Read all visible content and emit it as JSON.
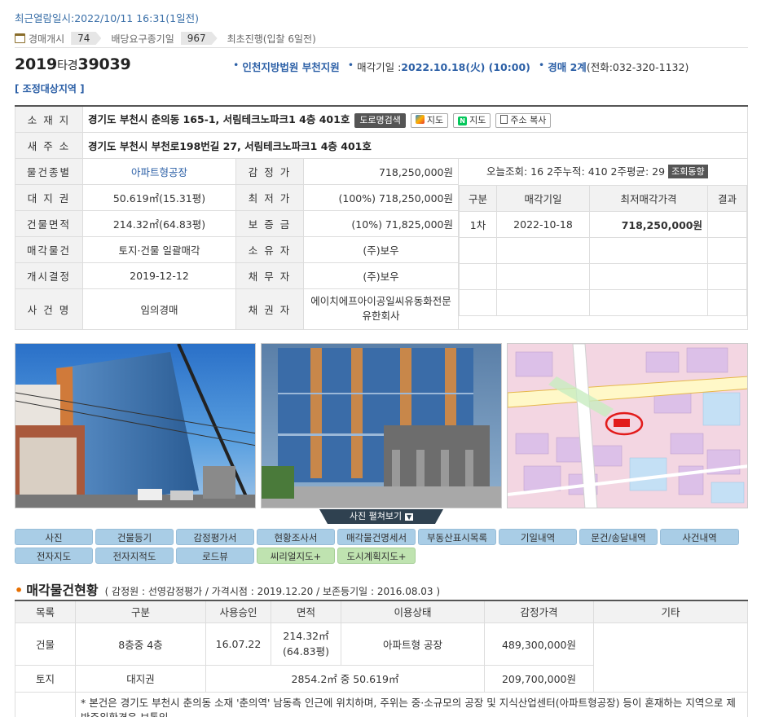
{
  "recent_view": "최근열람일시:2022/10/11 16:31(1일전)",
  "stats": {
    "auction_start_label": "경매개시",
    "auction_start_count": "74",
    "dividend_label": "배당요구종기일",
    "dividend_count": "967",
    "first_proceed": "최초진행(입찰 6일전)"
  },
  "case": {
    "year": "2019",
    "type": "타경",
    "number": "39039",
    "court": "인천지방법원 부천지원",
    "sale_date_label": "매각기일 : ",
    "sale_date": "2022.10.18(火) (10:00)",
    "dept": "경매 2계",
    "phone": "(전화:032-320-1132)",
    "adjust_area": "[ 조정대상지역 ]"
  },
  "buttons": {
    "road_search": "도로명검색",
    "daum_map": "지도",
    "naver_map": "지도",
    "copy_address": "주소 복사",
    "trend": "조회동향"
  },
  "info": {
    "location_label": "소 재 지",
    "location": "경기도 부천시 춘의동 165-1, 서림테크노파크1 4층 401호",
    "new_addr_label": "새 주 소",
    "new_addr": "경기도 부천시 부천로198번길 27, 서림테크노파크1 4층 401호",
    "rows": [
      {
        "l1": "물건종별",
        "v1": "아파트형공장",
        "l2": "감 정 가",
        "v2": "718,250,000원"
      },
      {
        "l1": "대 지 권",
        "v1": "50.619㎡(15.31평)",
        "l2": "최 저 가",
        "v2": "(100%) 718,250,000원"
      },
      {
        "l1": "건물면적",
        "v1": "214.32㎡(64.83평)",
        "l2": "보 증 금",
        "v2": "(10%) 71,825,000원"
      },
      {
        "l1": "매각물건",
        "v1": "토지·건물 일괄매각",
        "l2": "소 유 자",
        "v2": "(주)보우"
      },
      {
        "l1": "개시결정",
        "v1": "2019-12-12",
        "l2": "채 무 자",
        "v2": "(주)보우"
      },
      {
        "l1": "사 건 명",
        "v1": "임의경매",
        "l2": "채 권 자",
        "v2": "에이치에프아이공일씨유동화전문유한회사"
      }
    ],
    "views": "오늘조회: 16  2주누적: 410  2주평균: 29"
  },
  "bids": {
    "headers": [
      "구분",
      "매각기일",
      "최저매각가격",
      "결과"
    ],
    "rows": [
      {
        "round": "1차",
        "date": "2022-10-18",
        "price": "718,250,000원",
        "result": ""
      }
    ]
  },
  "expand_photos": "사진 펼쳐보기",
  "tabs_row1": [
    "사진",
    "건물등기",
    "감정평가서",
    "현황조사서",
    "매각물건명세서",
    "부동산표시목록",
    "기일내역",
    "문건/송달내역",
    "사건내역"
  ],
  "tabs_row2": [
    "전자지도",
    "전자지적도",
    "로드뷰",
    "씨리얼지도+",
    "도시계획지도+"
  ],
  "section": {
    "title": "매각물건현황",
    "sub": "( 감정원 : 선영감정평가 / 가격시점 : 2019.12.20 / 보존등기일 : 2016.08.03 )"
  },
  "property": {
    "headers": [
      "목록",
      "구분",
      "사용승인",
      "면적",
      "이용상태",
      "감정가격",
      "기타"
    ],
    "building": {
      "list": "건물",
      "kind": "8층중 4층",
      "approved": "16.07.22",
      "area1": "214.32㎡",
      "area2": "(64.83평)",
      "use": "아파트형 공장",
      "price": "489,300,000원"
    },
    "land": {
      "list": "토지",
      "kind": "대지권",
      "area": "2854.2㎡ 중 50.619㎡",
      "price": "209,700,000원"
    },
    "note": "* 본건은 경기도 부천시 춘의동 소재 '춘의역' 남동측 인근에 위치하며, 주위는 중·소규모의 공장 및 지식산업센터(아파트형공장) 등이 혼재하는 지역으로 제반주위환경은 보통임."
  },
  "colors": {
    "accent": "#2b5fa6",
    "orange": "#e76f00",
    "tab_blue": "#a9cde6",
    "tab_green": "#bfe3b0"
  }
}
